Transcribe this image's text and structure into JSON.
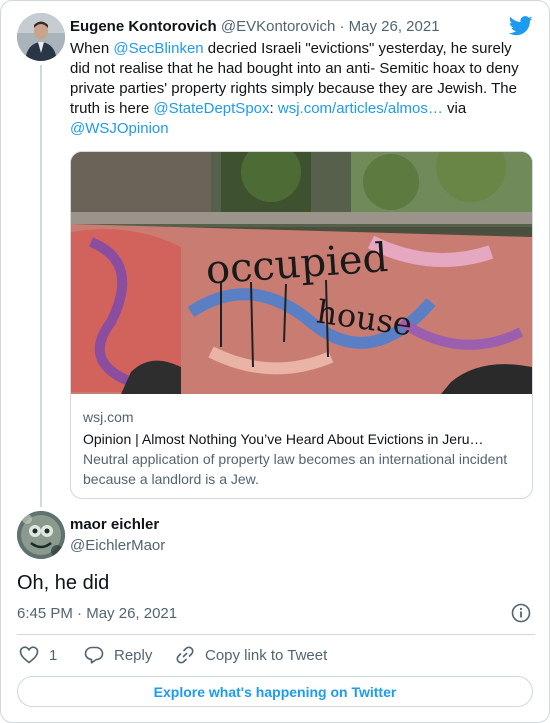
{
  "tweet": {
    "author_name": "Eugene Kontorovich",
    "author_handle": "@EVKontorovich",
    "separator": "·",
    "date": "May 26, 2021",
    "text_segments": [
      {
        "text": "When ",
        "link": false
      },
      {
        "text": "@SecBlinken",
        "link": true
      },
      {
        "text": " decried Israeli \"evictions\" yesterday, he surely did not realise that he had bought into an anti- Semitic  hoax to deny private parties' property rights simply because they are Jewish. The truth is here ",
        "link": false
      },
      {
        "text": "@StateDeptSpox",
        "link": true
      },
      {
        "text": ":  ",
        "link": false
      },
      {
        "text": "wsj.com/articles/almos…",
        "link": true
      },
      {
        "text": " via ",
        "link": false
      },
      {
        "text": "@WSJOpinion",
        "link": true
      }
    ],
    "link_card": {
      "image_icon": "graffiti-wall-photo",
      "image_text_1": "occupied",
      "image_text_2": "house",
      "domain": "wsj.com",
      "title": "Opinion | Almost Nothing You’ve Heard About Evictions in Jeru…",
      "description": "Neutral application of property law becomes an international incident because a landlord is a Jew."
    }
  },
  "reply": {
    "author_name": "maor eichler",
    "author_handle": "@EichlerMaor",
    "text": "Oh, he did",
    "time": "6:45 PM",
    "separator": "·",
    "date": "May 26, 2021"
  },
  "actions": {
    "like_count": "1",
    "reply_label": "Reply",
    "copy_link_label": "Copy link to Tweet"
  },
  "explore_label": "Explore what's happening on Twitter",
  "colors": {
    "accent": "#1d9bf0",
    "secondary_text": "#536471",
    "border": "#cfd9de"
  }
}
